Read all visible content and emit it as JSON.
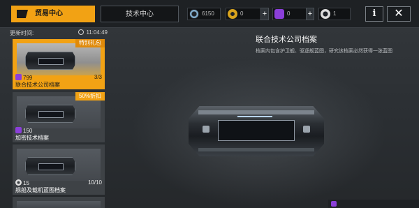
{
  "topbar": {
    "tabs": [
      {
        "label": "贸易中心",
        "active": true
      },
      {
        "label": "技术中心",
        "active": false
      }
    ],
    "currencies": [
      {
        "icon": "credits-icon",
        "value": "6150",
        "color": "#7fa9c8"
      },
      {
        "icon": "gold-coin-icon",
        "value": "0",
        "color": "#d9a41d",
        "plus": "+"
      },
      {
        "icon": "purple-token-icon",
        "value": "0",
        "color": "#8b3fd9",
        "plus": "+"
      },
      {
        "icon": "silver-coin-icon",
        "value": "1",
        "color": "#dcdcdc"
      }
    ],
    "info_label": "i",
    "close_label": "✕"
  },
  "list": {
    "refresh_label": "更新时间:",
    "timer": "11:04:49",
    "items": [
      {
        "badge": "特别礼包",
        "price": "799",
        "currency": "purple-token-icon",
        "stock": "3/3",
        "name": "联合技术公司档案",
        "selected": true
      },
      {
        "badge": "50%折扣",
        "price": "150",
        "currency": "purple-token-icon",
        "stock": "",
        "name": "加密技术档案",
        "selected": false
      },
      {
        "badge": "",
        "price": "15",
        "currency": "silver-coin-icon",
        "stock": "10/10",
        "name": "舰船及载机蓝图档案",
        "selected": false
      }
    ]
  },
  "detail": {
    "title": "联合技术公司档案",
    "description": "档案内包含护卫舰、驱逐舰蓝图，研究该档案必然获得一张蓝图"
  },
  "colors": {
    "accent": "#f2a214",
    "purple": "#8b3fd9"
  }
}
